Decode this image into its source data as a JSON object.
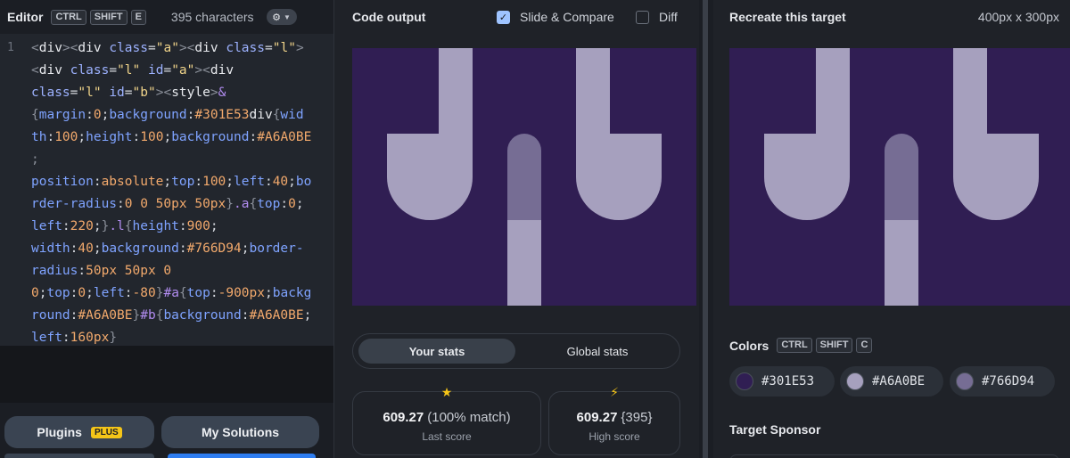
{
  "editor": {
    "title": "Editor",
    "shortcut": [
      "CTRL",
      "SHIFT",
      "E"
    ],
    "char_count": "395 characters",
    "gear_icon": "gear-icon",
    "line_number": "1",
    "plugins_label": "Plugins",
    "plugins_badge": "PLUS",
    "solutions_label": "My Solutions"
  },
  "output": {
    "title": "Code output",
    "slide_compare_label": "Slide & Compare",
    "slide_compare_checked": true,
    "diff_label": "Diff",
    "diff_checked": false,
    "tabs": [
      "Your stats",
      "Global stats"
    ],
    "active_tab": "Your stats",
    "last_score": {
      "value": "609.27",
      "detail": "(100% match)",
      "label": "Last score",
      "icon": "star-icon"
    },
    "high_score": {
      "value": "609.27",
      "detail": "{395}",
      "label": "High score",
      "icon": "lightning-icon"
    }
  },
  "target": {
    "title": "Recreate this target",
    "dimensions": "400px x 300px",
    "colors_title": "Colors",
    "colors_shortcut": [
      "CTRL",
      "SHIFT",
      "C"
    ],
    "colors": [
      {
        "hex": "#301E53",
        "label": "#301E53"
      },
      {
        "hex": "#A6A0BE",
        "label": "#A6A0BE"
      },
      {
        "hex": "#766D94",
        "label": "#766D94"
      }
    ],
    "sponsor_title": "Target Sponsor"
  },
  "palette": {
    "background": "#301E53",
    "light": "#A6A0BE",
    "mid": "#766D94"
  }
}
